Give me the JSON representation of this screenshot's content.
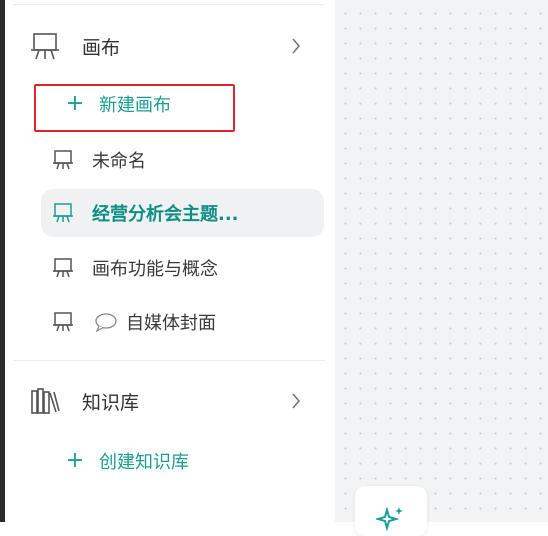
{
  "canvas_section": {
    "title": "画布",
    "icon": "easel-icon"
  },
  "new_canvas": {
    "label": "新建画布"
  },
  "canvas_items": [
    {
      "label": "未命名",
      "icon": "easel-icon"
    },
    {
      "label": "经营分析会主题...",
      "icon": "easel-icon",
      "active": true
    },
    {
      "label": "画布功能与概念",
      "icon": "easel-icon"
    },
    {
      "label": "自媒体封面",
      "icon": "easel-icon",
      "extra_icon": "chat-bubble-icon"
    }
  ],
  "knowledge_section": {
    "title": "知识库",
    "icon": "books-icon"
  },
  "create_knowledge": {
    "label": "创建知识库"
  },
  "colors": {
    "accent": "#1a9e92",
    "highlight": "#e2232a"
  },
  "floating_button": {
    "icon": "sparkle-icon"
  }
}
